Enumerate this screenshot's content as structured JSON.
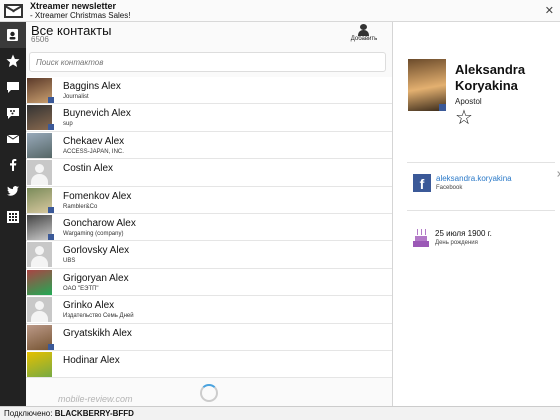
{
  "notification": {
    "title": "Xtreamer newsletter",
    "body": "- Xtreamer Christmas Sales!",
    "close": "✕"
  },
  "rail": [
    "contacts-icon",
    "star-icon",
    "chat-icon",
    "bbm-icon",
    "mail-icon",
    "facebook-icon",
    "twitter-icon",
    "grid-icon"
  ],
  "list": {
    "title": "Все контакты",
    "count": "6506",
    "add_label": "Добавить",
    "search_placeholder": "Поиск контактов",
    "contacts": [
      {
        "name": "Baggins Alex",
        "sub": "Journalist"
      },
      {
        "name": "Buynevich Alex",
        "sub": "sup"
      },
      {
        "name": "Chekaev Alex",
        "sub": "ACCESS-JAPAN, INC."
      },
      {
        "name": "Costin Alex",
        "sub": ""
      },
      {
        "name": "Fomenkov Alex",
        "sub": "Rambler&Co"
      },
      {
        "name": "Goncharow Alex",
        "sub": "Wargaming (company)"
      },
      {
        "name": "Gorlovsky Alex",
        "sub": "UBS"
      },
      {
        "name": "Grigoryan Alex",
        "sub": "OAO \"ЕЭТП\""
      },
      {
        "name": "Grinko Alex",
        "sub": "Издательство Семь Дней"
      },
      {
        "name": "Gryatskikh Alex",
        "sub": ""
      },
      {
        "name": "Hodinar Alex",
        "sub": ""
      }
    ],
    "watermark": "mobile-review.com"
  },
  "detail": {
    "first_name": "Aleksandra",
    "last_name": "Koryakina",
    "org": "Apostol",
    "star": "☆",
    "facebook_handle": "aleksandra.koryakina",
    "facebook_label": "Facebook",
    "birthday": "25 июля 1900 г.",
    "birthday_label": "День рождения"
  },
  "status": {
    "prefix": "Подключено: ",
    "device": "BLACKBERRY-BFFD"
  },
  "colors": {
    "rail": "#222222",
    "facebook": "#3b5998",
    "link": "#2a79c8",
    "cake": "#9b59b6"
  }
}
